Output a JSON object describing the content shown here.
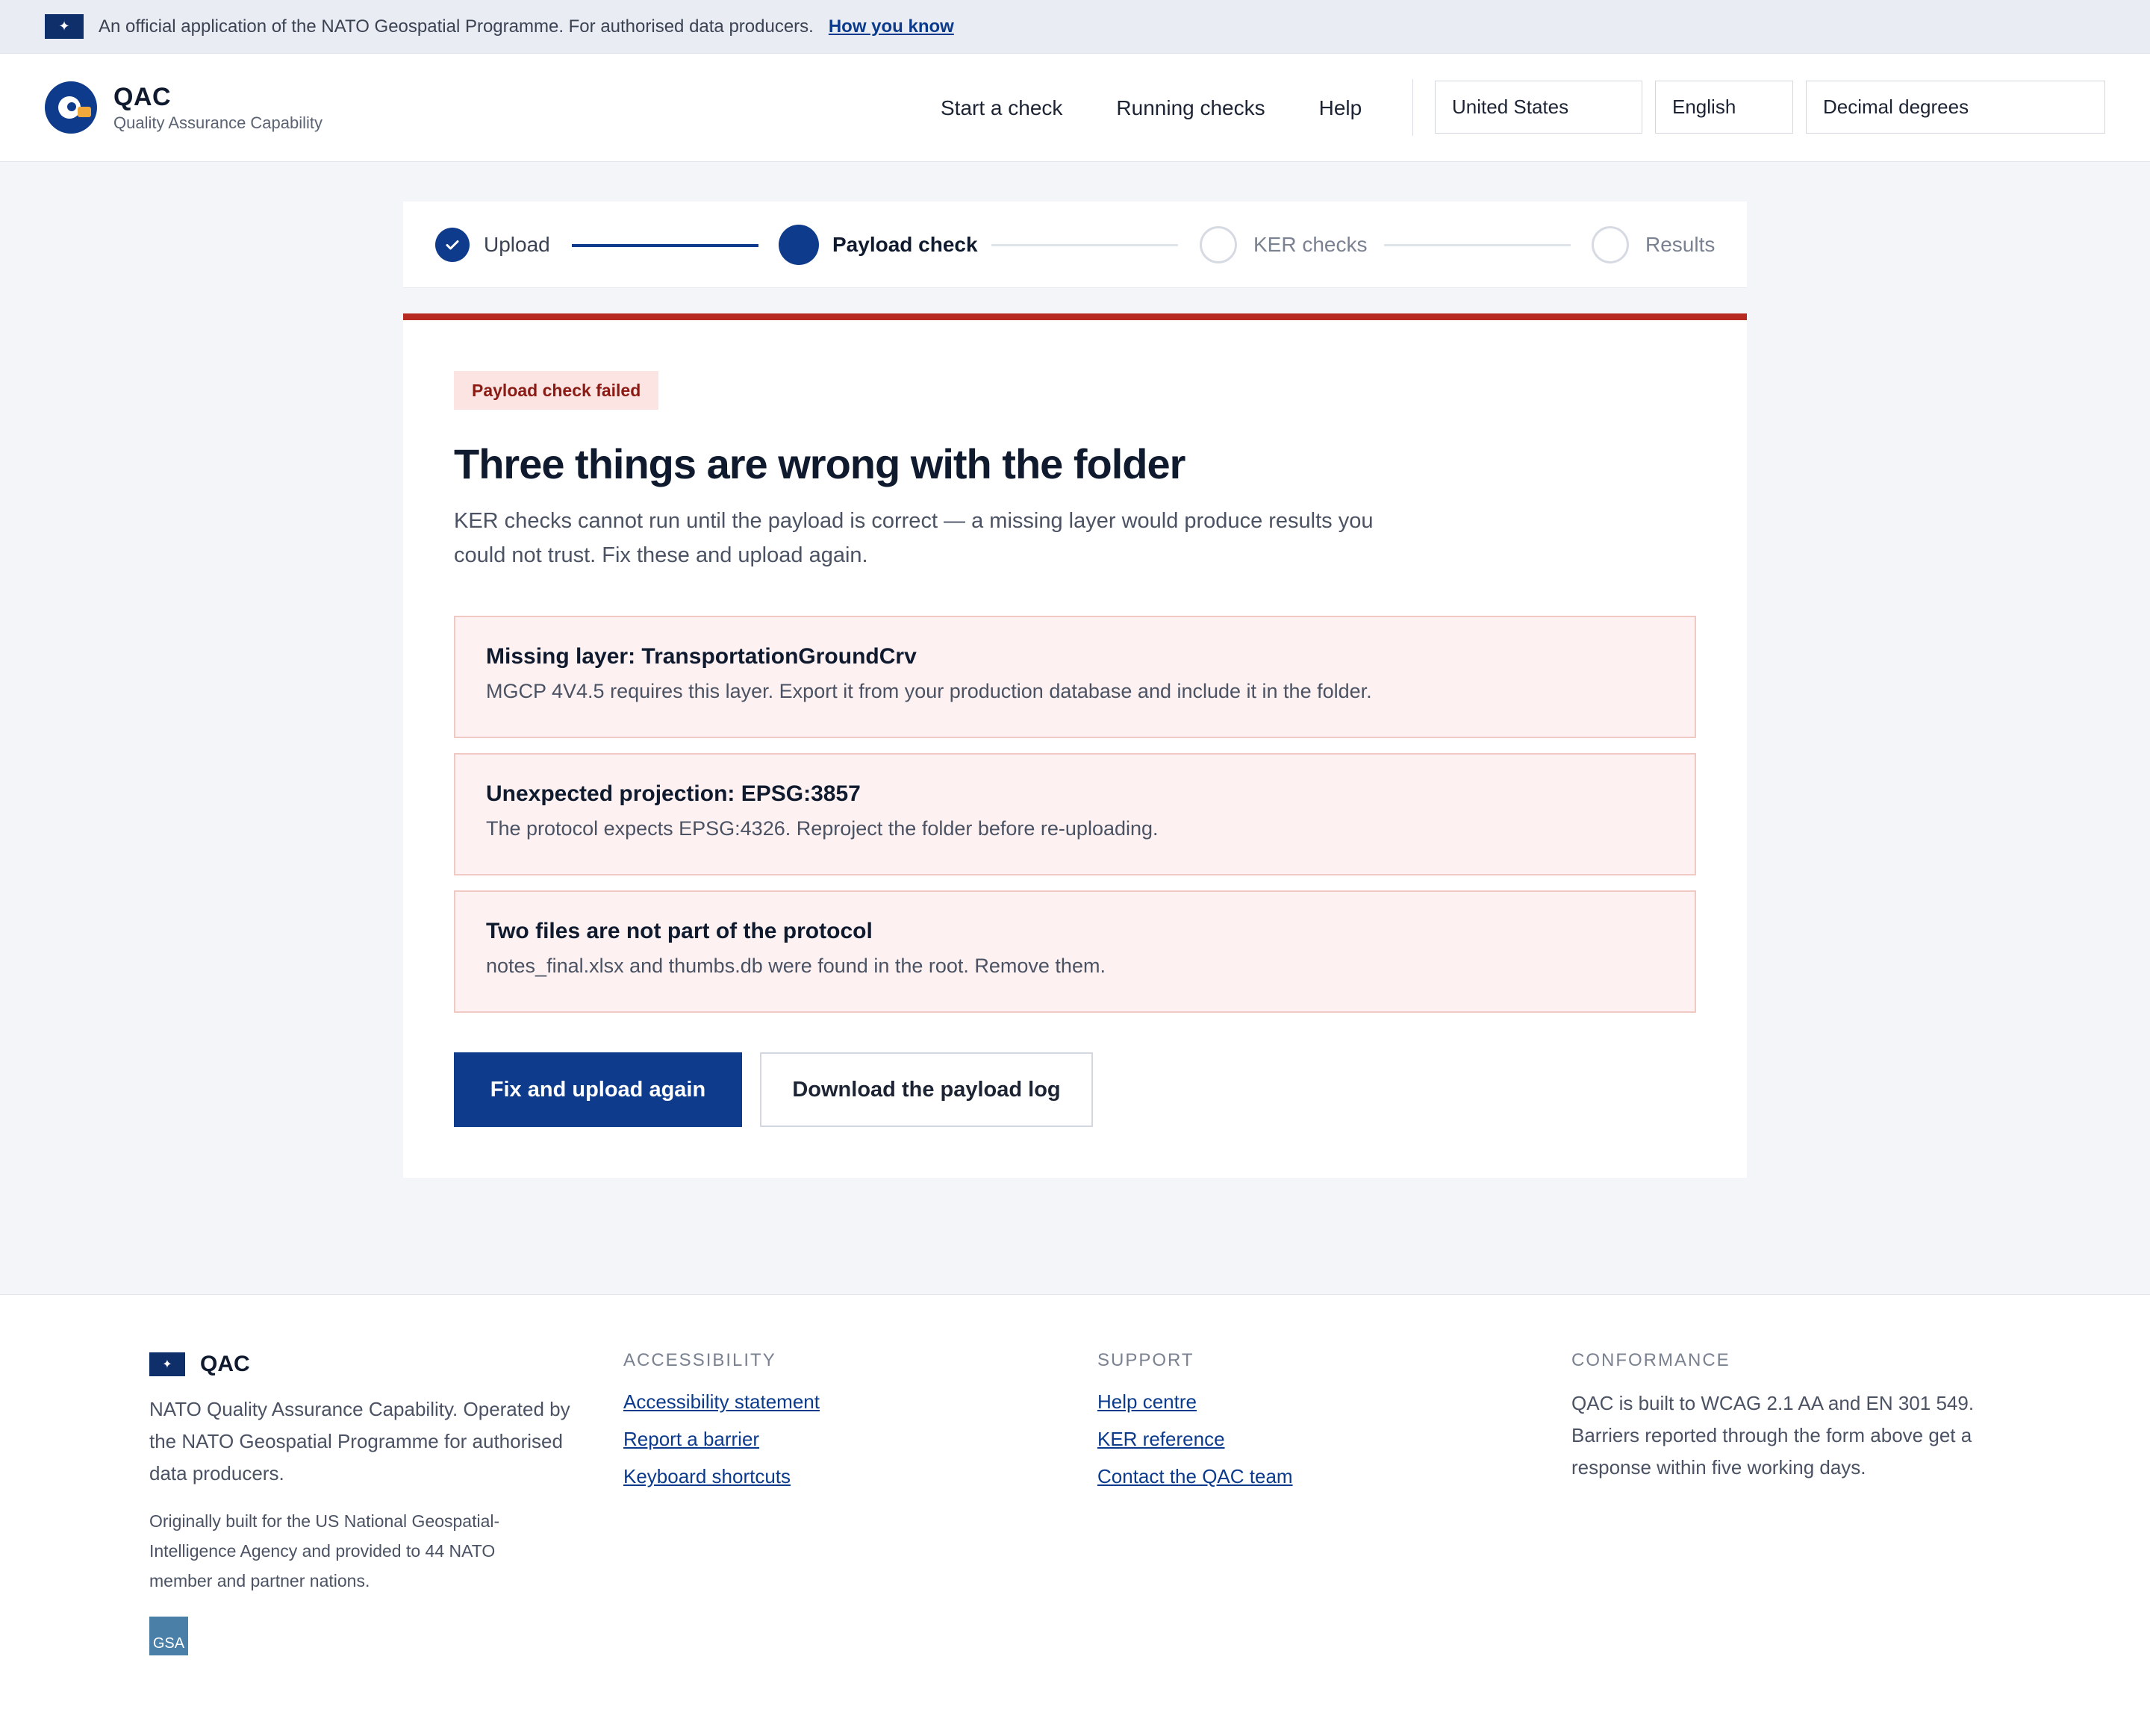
{
  "banner": {
    "text": "An official application of the NATO Geospatial Programme. For authorised data producers.",
    "link": "How you know",
    "flag_icon": "nato-flag-icon"
  },
  "header": {
    "brand_name": "QAC",
    "brand_sub": "Quality Assurance Capability",
    "nav": [
      "Start a check",
      "Running checks",
      "Help"
    ],
    "country": "United States",
    "language": "English",
    "coordinates": "Decimal degrees"
  },
  "stepper": {
    "steps": [
      {
        "label": "Upload",
        "state": "done"
      },
      {
        "label": "Payload check",
        "state": "current"
      },
      {
        "label": "KER checks",
        "state": "pending"
      },
      {
        "label": "Results",
        "state": "pending"
      }
    ]
  },
  "card": {
    "badge": "Payload check failed",
    "title": "Three things are wrong with the folder",
    "lead": "KER checks cannot run until the payload is correct — a missing layer would produce results you could not trust. Fix these and upload again.",
    "issues": [
      {
        "title": "Missing layer: TransportationGroundCrv",
        "body": "MGCP 4V4.5 requires this layer. Export it from your production database and include it in the folder."
      },
      {
        "title": "Unexpected projection: EPSG:3857",
        "body": "The protocol expects EPSG:4326. Reproject the folder before re-uploading."
      },
      {
        "title": "Two files are not part of the protocol",
        "body": "notes_final.xlsx and thumbs.db were found in the root. Remove them."
      }
    ],
    "primary_button": "Fix and upload again",
    "secondary_button": "Download the payload log"
  },
  "footer": {
    "brand_name": "QAC",
    "about": "NATO Quality Assurance Capability. Operated by the NATO Geospatial Programme for authorised data producers.",
    "origin": "Originally built for the US National Geospatial-Intelligence Agency and provided to 44 NATO member and partner nations.",
    "gsa_label": "GSA",
    "accessibility": {
      "heading": "ACCESSIBILITY",
      "links": [
        "Accessibility statement",
        "Report a barrier",
        "Keyboard shortcuts"
      ]
    },
    "support": {
      "heading": "SUPPORT",
      "links": [
        "Help centre",
        "KER reference",
        "Contact the QAC team"
      ]
    },
    "conformance": {
      "heading": "CONFORMANCE",
      "text": "QAC is built to WCAG 2.1 AA and EN 301 549. Barriers reported through the form above get a response within five working days."
    }
  },
  "colors": {
    "brand_blue": "#0f3b8c",
    "error_red": "#b72a22",
    "error_bg": "#fdf2f1"
  }
}
